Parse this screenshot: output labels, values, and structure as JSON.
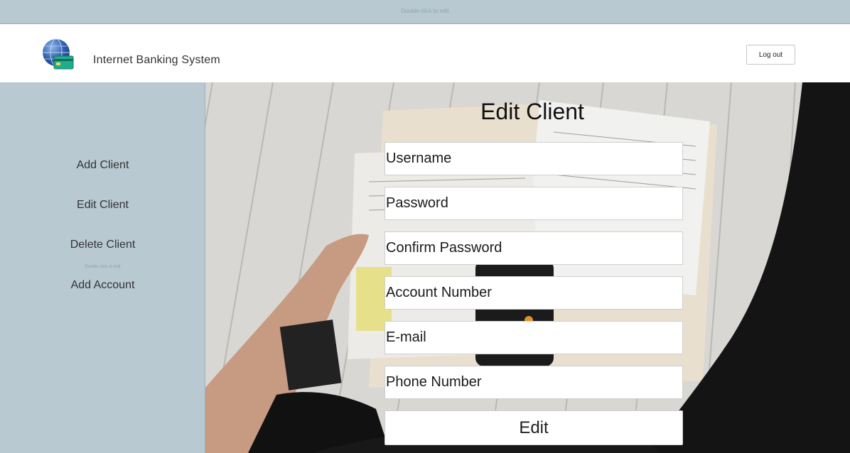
{
  "top_bar": {
    "hint": "Double click to edit"
  },
  "header": {
    "logo_icon": "globe-card-icon",
    "brand": "Internet Banking System",
    "logout_label": "Log out"
  },
  "sidebar": {
    "items": [
      {
        "label": "Add Client"
      },
      {
        "label": "Edit Client"
      },
      {
        "label": "Delete Client"
      },
      {
        "label": "Add Account"
      }
    ],
    "hint": "Double click to edit"
  },
  "form": {
    "title": "Edit Client",
    "fields": [
      {
        "placeholder": "Username"
      },
      {
        "placeholder": "Password"
      },
      {
        "placeholder": "Confirm Password"
      },
      {
        "placeholder": "Account Number"
      },
      {
        "placeholder": "E-mail"
      },
      {
        "placeholder": "Phone Number"
      }
    ],
    "submit_label": "Edit"
  },
  "colors": {
    "sidebar_bg": "#b8c9d1",
    "header_bg": "#ffffff"
  }
}
